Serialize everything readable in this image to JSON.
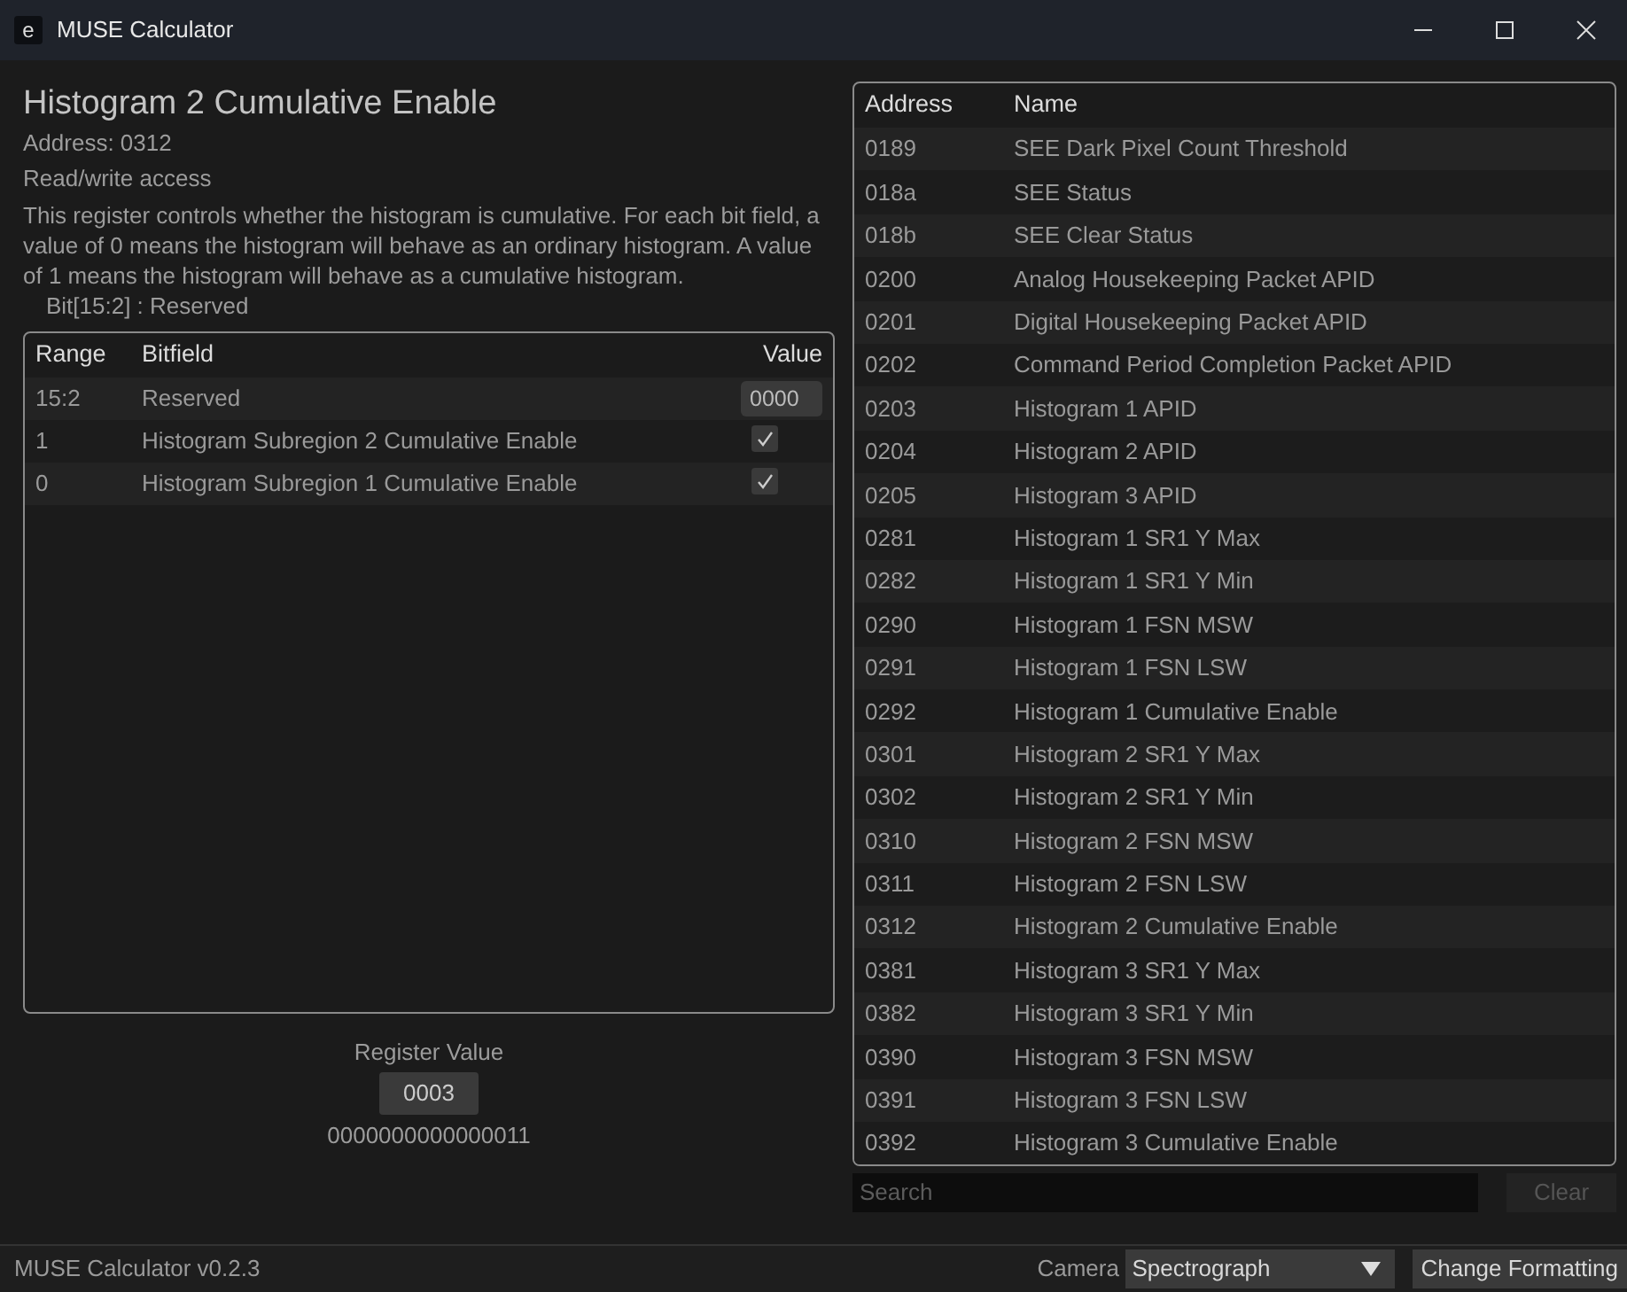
{
  "window": {
    "logo": "e",
    "title": "MUSE Calculator"
  },
  "register": {
    "title": "Histogram 2 Cumulative Enable",
    "address": "Address: 0312",
    "access": "Read/write access",
    "description": "This register controls whether the histogram is cumulative. For each bit field, a value of 0 means the histogram will behave as an ordinary histogram. A value of 1 means the histogram will behave as a cumulative histogram.",
    "bit_note": "Bit[15:2] : Reserved"
  },
  "bitfields": {
    "columns": [
      "Range",
      "Bitfield",
      "Value"
    ],
    "rows": [
      {
        "range": "15:2",
        "name": "Reserved",
        "kind": "field",
        "value": "0000"
      },
      {
        "range": "1",
        "name": "Histogram Subregion 2 Cumulative Enable",
        "kind": "checkbox",
        "checked": true
      },
      {
        "range": "0",
        "name": "Histogram Subregion 1 Cumulative Enable",
        "kind": "checkbox",
        "checked": true
      }
    ]
  },
  "register_value": {
    "label": "Register Value",
    "hex": "0003",
    "binary": "0000000000000011"
  },
  "registers": {
    "columns": [
      "Address",
      "Name"
    ],
    "rows": [
      {
        "address": "0189",
        "name": "SEE Dark Pixel Count Threshold"
      },
      {
        "address": "018a",
        "name": "SEE Status"
      },
      {
        "address": "018b",
        "name": "SEE Clear Status"
      },
      {
        "address": "0200",
        "name": "Analog Housekeeping Packet APID"
      },
      {
        "address": "0201",
        "name": "Digital Housekeeping Packet APID"
      },
      {
        "address": "0202",
        "name": "Command Period Completion Packet APID"
      },
      {
        "address": "0203",
        "name": "Histogram 1 APID"
      },
      {
        "address": "0204",
        "name": "Histogram 2 APID"
      },
      {
        "address": "0205",
        "name": "Histogram 3 APID"
      },
      {
        "address": "0281",
        "name": "Histogram 1 SR1 Y Max"
      },
      {
        "address": "0282",
        "name": "Histogram 1 SR1 Y Min"
      },
      {
        "address": "0290",
        "name": "Histogram 1 FSN MSW"
      },
      {
        "address": "0291",
        "name": "Histogram 1 FSN LSW"
      },
      {
        "address": "0292",
        "name": "Histogram 1 Cumulative Enable"
      },
      {
        "address": "0301",
        "name": "Histogram 2 SR1 Y Max"
      },
      {
        "address": "0302",
        "name": "Histogram 2 SR1 Y Min"
      },
      {
        "address": "0310",
        "name": "Histogram 2 FSN MSW"
      },
      {
        "address": "0311",
        "name": "Histogram 2 FSN LSW"
      },
      {
        "address": "0312",
        "name": "Histogram 2 Cumulative Enable"
      },
      {
        "address": "0381",
        "name": "Histogram 3 SR1 Y Max"
      },
      {
        "address": "0382",
        "name": "Histogram 3 SR1 Y Min"
      },
      {
        "address": "0390",
        "name": "Histogram 3 FSN MSW"
      },
      {
        "address": "0391",
        "name": "Histogram 3 FSN LSW"
      },
      {
        "address": "0392",
        "name": "Histogram 3 Cumulative Enable"
      }
    ]
  },
  "search": {
    "placeholder": "Search",
    "clear": "Clear"
  },
  "status_bar": {
    "version": "MUSE Calculator v0.2.3",
    "camera_label": "Camera",
    "camera": "Spectrograph",
    "formatting": "Change Formatting"
  }
}
